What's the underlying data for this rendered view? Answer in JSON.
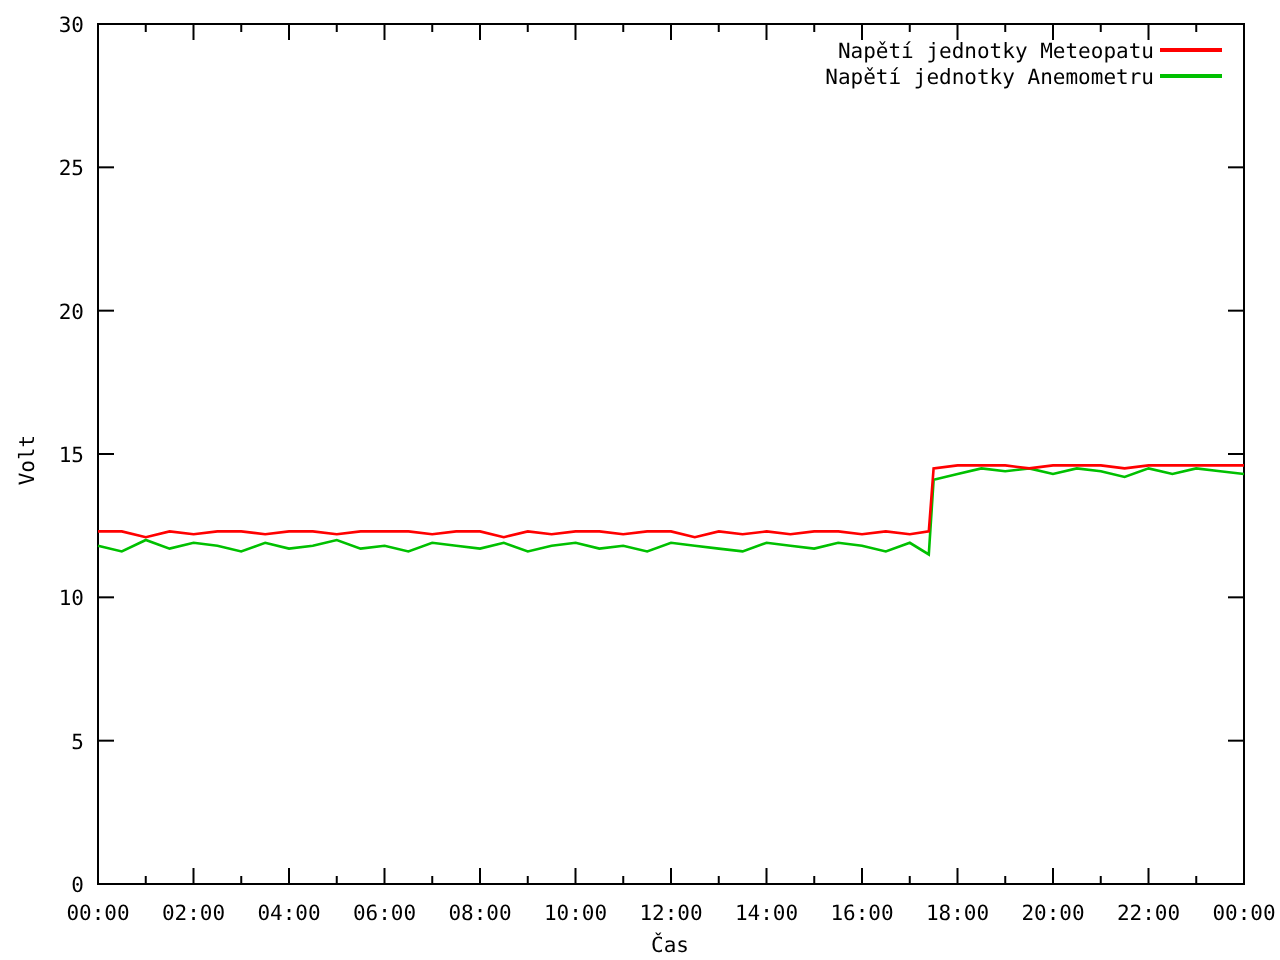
{
  "chart_data": {
    "type": "line",
    "xlabel": "Čas",
    "ylabel": "Volt",
    "x": [
      0,
      0.5,
      1,
      1.5,
      2,
      2.5,
      3,
      3.5,
      4,
      4.5,
      5,
      5.5,
      6,
      6.5,
      7,
      7.5,
      8,
      8.5,
      9,
      9.5,
      10,
      10.5,
      11,
      11.5,
      12,
      12.5,
      13,
      13.5,
      14,
      14.5,
      15,
      15.5,
      16,
      16.5,
      17,
      17.4,
      17.5,
      18,
      18.5,
      19,
      19.5,
      20,
      20.5,
      21,
      21.5,
      22,
      22.5,
      23,
      23.5,
      24
    ],
    "series": [
      {
        "name": "Napětí jednotky Meteopatu",
        "color": "#ff0000",
        "values": [
          12.3,
          12.3,
          12.1,
          12.3,
          12.2,
          12.3,
          12.3,
          12.2,
          12.3,
          12.3,
          12.2,
          12.3,
          12.3,
          12.3,
          12.2,
          12.3,
          12.3,
          12.1,
          12.3,
          12.2,
          12.3,
          12.3,
          12.2,
          12.3,
          12.3,
          12.1,
          12.3,
          12.2,
          12.3,
          12.2,
          12.3,
          12.3,
          12.2,
          12.3,
          12.2,
          12.3,
          14.5,
          14.6,
          14.6,
          14.6,
          14.5,
          14.6,
          14.6,
          14.6,
          14.5,
          14.6,
          14.6,
          14.6,
          14.6,
          14.6
        ]
      },
      {
        "name": "Napětí jednotky Anemometru",
        "color": "#00c000",
        "values": [
          11.8,
          11.6,
          12.0,
          11.7,
          11.9,
          11.8,
          11.6,
          11.9,
          11.7,
          11.8,
          12.0,
          11.7,
          11.8,
          11.6,
          11.9,
          11.8,
          11.7,
          11.9,
          11.6,
          11.8,
          11.9,
          11.7,
          11.8,
          11.6,
          11.9,
          11.8,
          11.7,
          11.6,
          11.9,
          11.8,
          11.7,
          11.9,
          11.8,
          11.6,
          11.9,
          11.5,
          14.1,
          14.3,
          14.5,
          14.4,
          14.5,
          14.3,
          14.5,
          14.4,
          14.2,
          14.5,
          14.3,
          14.5,
          14.4,
          14.3
        ]
      }
    ],
    "legend": "top-right",
    "xlim": [
      0,
      24
    ],
    "ylim": [
      0,
      30
    ],
    "xticks": [
      {
        "value": 0,
        "label": "00:00"
      },
      {
        "value": 2,
        "label": "02:00"
      },
      {
        "value": 4,
        "label": "04:00"
      },
      {
        "value": 6,
        "label": "06:00"
      },
      {
        "value": 8,
        "label": "08:00"
      },
      {
        "value": 10,
        "label": "10:00"
      },
      {
        "value": 12,
        "label": "12:00"
      },
      {
        "value": 14,
        "label": "14:00"
      },
      {
        "value": 16,
        "label": "16:00"
      },
      {
        "value": 18,
        "label": "18:00"
      },
      {
        "value": 20,
        "label": "20:00"
      },
      {
        "value": 22,
        "label": "22:00"
      },
      {
        "value": 24,
        "label": "00:00"
      }
    ],
    "yticks": [
      0,
      5,
      10,
      15,
      20,
      25,
      30
    ]
  }
}
